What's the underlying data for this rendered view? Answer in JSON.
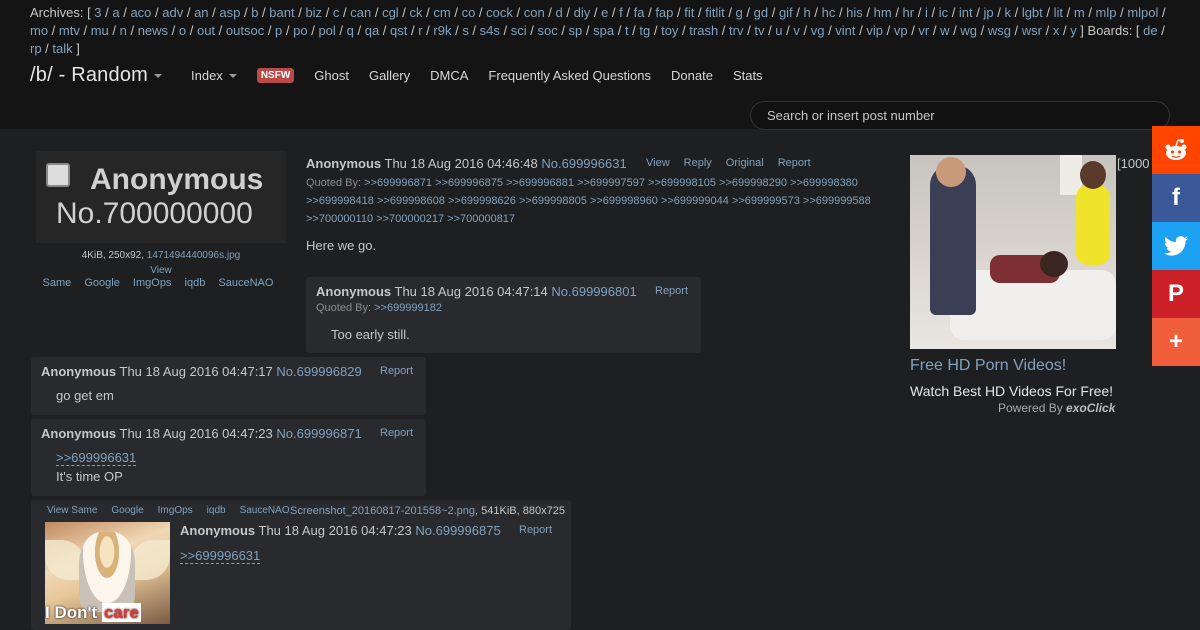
{
  "archives": {
    "prefix": "Archives: [",
    "items": [
      "3",
      "a",
      "aco",
      "adv",
      "an",
      "asp",
      "b",
      "bant",
      "biz",
      "c",
      "can",
      "cgl",
      "ck",
      "cm",
      "co",
      "cock",
      "con",
      "d",
      "diy",
      "e",
      "f",
      "fa",
      "fap",
      "fit",
      "fitlit",
      "g",
      "gd",
      "gif",
      "h",
      "hc",
      "his",
      "hm",
      "hr",
      "i",
      "ic",
      "int",
      "jp",
      "k",
      "lgbt",
      "lit",
      "m",
      "mlp",
      "mlpol",
      "mo",
      "mtv",
      "mu",
      "n",
      "news",
      "o",
      "out",
      "outsoc",
      "p",
      "po",
      "pol",
      "q",
      "qa",
      "qst",
      "r",
      "r9k",
      "s",
      "s4s",
      "sci",
      "soc",
      "sp",
      "spa",
      "t",
      "tg",
      "toy",
      "trash",
      "trv",
      "tv",
      "u",
      "v",
      "vg",
      "vint",
      "vip",
      "vp",
      "vr",
      "w",
      "wg",
      "wsg",
      "wsr",
      "x",
      "y"
    ],
    "boards_prefix": "] Boards: [",
    "boards": [
      "de",
      "rp",
      "talk"
    ],
    "suffix": "]"
  },
  "header": {
    "board_title": "/b/ - Random",
    "nav": {
      "index": "Index",
      "nsfw": "NSFW",
      "ghost": "Ghost",
      "gallery": "Gallery",
      "dmca": "DMCA",
      "faq": "Frequently Asked Questions",
      "donate": "Donate",
      "stats": "Stats"
    },
    "search_placeholder": "Search or insert post number"
  },
  "op": {
    "thumb_text_1": "Anonymous",
    "thumb_text_2": "No.700000000",
    "file_info": "4KiB, 250x92,",
    "file_name": "1471494440096s.jpg",
    "view": "View",
    "tools": [
      "Same",
      "Google",
      "ImgOps",
      "iqdb",
      "SauceNAO"
    ],
    "name": "Anonymous",
    "date": "Thu 18 Aug 2016 04:46:48",
    "number": "No.699996631",
    "actions": [
      "View",
      "Reply",
      "Original",
      "Report"
    ],
    "quoted_by_label": "Quoted By:",
    "quoted_by": [
      ">>699996871",
      ">>699996875",
      ">>699996881",
      ">>699997597",
      ">>699998105",
      ">>699998290",
      ">>699998380",
      ">>699998418",
      ">>699998608",
      ">>699998626",
      ">>699998805",
      ">>699998960",
      ">>699999044",
      ">>699999573",
      ">>699999588",
      ">>700000110",
      ">>700000217",
      ">>700000817"
    ],
    "body": "Here we go."
  },
  "replies": [
    {
      "name": "Anonymous",
      "date": "Thu 18 Aug 2016 04:47:14",
      "number": "No.699996801",
      "report": "Report",
      "quoted_by_label": "Quoted By:",
      "quoted_by": ">>699999182",
      "body": "Too early still."
    },
    {
      "name": "Anonymous",
      "date": "Thu 18 Aug 2016 04:47:17",
      "number": "No.699996829",
      "report": "Report",
      "body": "go get em"
    },
    {
      "name": "Anonymous",
      "date": "Thu 18 Aug 2016 04:47:23",
      "number": "No.699996871",
      "report": "Report",
      "quote": ">>699996631",
      "body": "It's time OP"
    },
    {
      "name": "Anonymous",
      "date": "Thu 18 Aug 2016 04:47:23",
      "number": "No.699996875",
      "report": "Report",
      "quote": ">>699996631",
      "tools": [
        "View Same",
        "Google",
        "ImgOps",
        "iqdb",
        "SauceNAO"
      ],
      "file_name": "Screenshot_20160817-201558~2.png",
      "file_info": ", 541KiB, 880x725",
      "thumb_caption_white": "I Don't",
      "thumb_caption_red": "care"
    }
  ],
  "ad": {
    "extra": "[1000",
    "title": "Free HD Porn Videos!",
    "subtitle": "Watch Best HD Videos For Free!",
    "powered_label": "Powered By",
    "powered_brand": "exoClick"
  },
  "social": {
    "reddit": "reddit-icon",
    "facebook": "f",
    "twitter": "twitter-icon",
    "pinterest": "P",
    "more": "+"
  }
}
